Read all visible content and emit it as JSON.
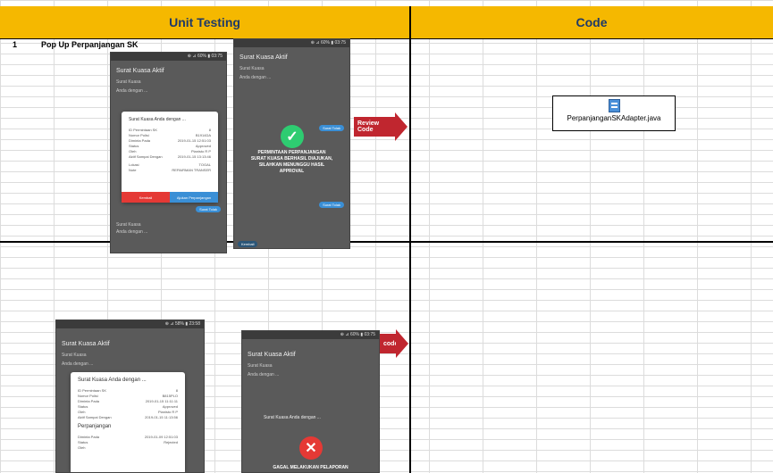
{
  "headers": {
    "unit_testing": "Unit Testing",
    "code": "Code"
  },
  "rows": [
    {
      "number": "1",
      "title": "Pop Up Perpanjangan SK"
    }
  ],
  "code_file": {
    "name": "PerpanjanganSKAdapter.java",
    "icon": "java-file-icon"
  },
  "arrows": {
    "review_code": "Review Code",
    "review_code_partial": "code"
  },
  "phone1": {
    "status": "⊕ ⊿ 60% ▮ 03:75",
    "screen_title": "Surat Kuasa Aktif",
    "list_a": "Surat Kuasa",
    "list_b": "Anda dengan ...",
    "dialog_title": "Surat Kuasa Anda dengan ...",
    "fields": [
      {
        "k": "ID Permintaan SK",
        "v": "8"
      },
      {
        "k": "Nomor Polisi",
        "v": "B1914DA"
      },
      {
        "k": "Diminta Pada",
        "v": "2019-01-15 12:51:03"
      },
      {
        "k": "Status",
        "v": "Approved"
      },
      {
        "k": "Oleh",
        "v": "Pianisto R P"
      },
      {
        "k": "Aktif Sampai Dengan",
        "v": "2019-01-15 13:13:46"
      }
    ],
    "section": "Lokasi",
    "extra": [
      {
        "k": "Lokasi",
        "v": "TOGAL"
      },
      {
        "k": "Note",
        "v": "REPAIRMAN TRANSER"
      }
    ],
    "cancel": "Kembali",
    "submit": "Ajukan Perpanjangan",
    "bottom_btn": "Surat Tolak",
    "bottom_a": "Surat Kuasa",
    "bottom_b": "Anda dengan ..."
  },
  "phone2": {
    "status": "⊕ ⊿ 60% ▮ 03:75",
    "screen_title": "Surat Kuasa Aktif",
    "list_a": "Surat Kuasa",
    "list_b": "Anda dengan ...",
    "message": "PERMINTAAN PERPANJANGAN SURAT KUASA BERHASIL DIAJUKAN, SILAHKAN MENUNGGU HASIL APPROVAL",
    "btn_top": "Surat Tolak",
    "btn_mid": "Surat Tolak",
    "btn_bottom": "Kembali"
  },
  "phone3": {
    "status": "⊕ ⊿ 58% ▮ 23:58",
    "screen_title": "Surat Kuasa Aktif",
    "list_a": "Surat Kuasa",
    "list_b": "Anda dengan ...",
    "dialog_title": "Surat Kuasa Anda dengan ...",
    "fields": [
      {
        "k": "ID Permintaan SK",
        "v": "8"
      },
      {
        "k": "Nomor Polisi",
        "v": "B815PLO"
      },
      {
        "k": "Diminta Pada",
        "v": "2019-01-15 11:11:11"
      },
      {
        "k": "Status",
        "v": "Approved"
      },
      {
        "k": "Oleh",
        "v": "Pianisto R P"
      },
      {
        "k": "Aktif Sampai Dengan",
        "v": "2019-01-15 11:13:56"
      }
    ],
    "section": "Perpanjangan",
    "extra": [
      {
        "k": "Diminta Pada",
        "v": "2019-01-09 12:51:03"
      },
      {
        "k": "Status",
        "v": "Rejected"
      },
      {
        "k": "Oleh",
        "v": ""
      }
    ]
  },
  "phone4": {
    "status": "⊕ ⊿ 60% ▮ 03:75",
    "screen_title": "Surat Kuasa Aktif",
    "list_a": "Surat Kuasa",
    "list_b": "Anda dengan ...",
    "dialog_title": "Surat Kuasa Anda dengan ...",
    "message": "GAGAL MELAKUKAN PELAPORAN"
  },
  "colors": {
    "header": "#f5b800",
    "arrow": "#c0262f",
    "success": "#2ecc71",
    "error": "#e53935"
  }
}
